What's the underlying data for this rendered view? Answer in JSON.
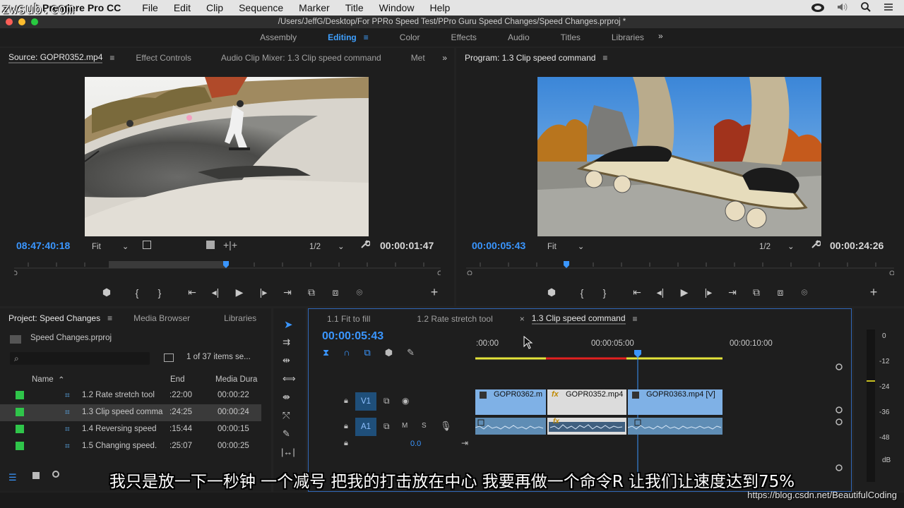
{
  "watermark_top": "zwsub.com",
  "menubar": {
    "app_name": "Premiere Pro CC",
    "items": [
      "File",
      "Edit",
      "Clip",
      "Sequence",
      "Marker",
      "Title",
      "Window",
      "Help"
    ]
  },
  "titlebar": {
    "path": "/Users/JeffG/Desktop/For PPRo Speed Test/PPro Guru Speed Changes/Speed Changes.prproj *"
  },
  "workspaces": {
    "items": [
      "Assembly",
      "Editing",
      "Color",
      "Effects",
      "Audio",
      "Titles",
      "Libraries"
    ],
    "active": "Editing",
    "more": "»"
  },
  "source": {
    "tabs": [
      "Source: GOPR0352.mp4",
      "Effect Controls",
      "Audio Clip Mixer: 1.3 Clip speed command",
      "Metad"
    ],
    "more": "»",
    "timecode_in": "08:47:40:18",
    "fit": "Fit",
    "resolution": "1/2",
    "duration": "00:00:01:47"
  },
  "program": {
    "tab": "Program: 1.3 Clip speed command",
    "timecode": "00:00:05:43",
    "fit": "Fit",
    "resolution": "1/2",
    "duration": "00:00:24:26"
  },
  "project": {
    "tabs": [
      "Project: Speed Changes",
      "Media Browser",
      "Libraries"
    ],
    "more": "»",
    "file": "Speed Changes.prproj",
    "search_placeholder": "",
    "items_count": "1 of 37 items se...",
    "columns": [
      "Name",
      "End",
      "Media Dura"
    ],
    "rows": [
      {
        "name": "1.2 Rate stretch tool",
        "end": ":22:00",
        "dur": "00:00:22"
      },
      {
        "name": "1.3 Clip speed comma",
        "end": ":24:25",
        "dur": "00:00:24"
      },
      {
        "name": "1.4 Reversing speed",
        "end": ":15:44",
        "dur": "00:00:15"
      },
      {
        "name": "1.5 Changing speed.",
        "end": ":25:07",
        "dur": "00:00:25"
      }
    ]
  },
  "timeline": {
    "tabs": [
      "1.1 Fit to fill",
      "1.2 Rate stretch tool",
      "1.3 Clip speed command"
    ],
    "close": "×",
    "timecode": "00:00:05:43",
    "ruler": [
      ":00:00",
      "00:00:05:00",
      "00:00:10:00"
    ],
    "tracks": {
      "v1": "V1",
      "a1": "A1",
      "mute": "M",
      "solo": "S",
      "volume": "0.0"
    },
    "clips": [
      "GOPR0362.m",
      "GOPR0352.mp4",
      "GOPR0363.mp4 [V]"
    ],
    "fx": "fx"
  },
  "meters": {
    "labels": [
      "0",
      "-12",
      "-24",
      "-36",
      "-48",
      "dB"
    ]
  },
  "subtitle": "我只是放一下一秒钟  一个减号  把我的打击放在中心  我要再做一个命令R  让我们让速度达到75%",
  "watermark_bottom": "https://blog.csdn.net/BeautifulCoding",
  "colors": {
    "accent": "#3a96ff",
    "clip_video": "#7fb1e6",
    "clip_selected": "#d9d9d9",
    "label_green": "#2fc54a"
  }
}
